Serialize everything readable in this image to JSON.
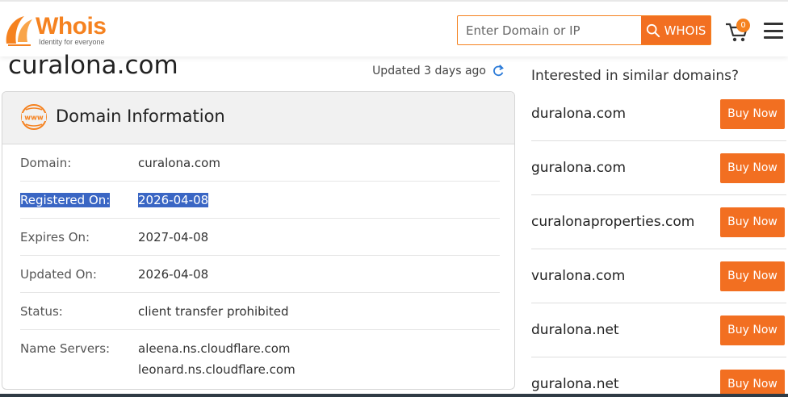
{
  "header": {
    "logo_text": "Whois",
    "logo_tagline": "Identity for everyone",
    "search_placeholder": "Enter Domain or IP",
    "search_button": "WHOIS",
    "cart_count": "0"
  },
  "page": {
    "domain": "curalona.com",
    "updated": "Updated 3 days ago"
  },
  "domain_info": {
    "title": "Domain Information",
    "rows": [
      {
        "label": "Domain:",
        "value": "curalona.com"
      },
      {
        "label": "Registered On:",
        "value": "2026-04-08"
      },
      {
        "label": "Expires On:",
        "value": "2027-04-08"
      },
      {
        "label": "Updated On:",
        "value": "2026-04-08"
      },
      {
        "label": "Status:",
        "value": "client transfer prohibited"
      }
    ],
    "name_servers_label": "Name Servers:",
    "name_servers": [
      "aleena.ns.cloudflare.com",
      "leonard.ns.cloudflare.com"
    ]
  },
  "similar": {
    "title": "Interested in similar domains?",
    "buy_label": "Buy Now",
    "items": [
      "duralona.com",
      "guralona.com",
      "curalonaproperties.com",
      "vuralona.com",
      "duralona.net",
      "guralona.net"
    ]
  },
  "colors": {
    "brand": "#f58220",
    "button": "#f26f21",
    "selection": "#3a66c4"
  }
}
